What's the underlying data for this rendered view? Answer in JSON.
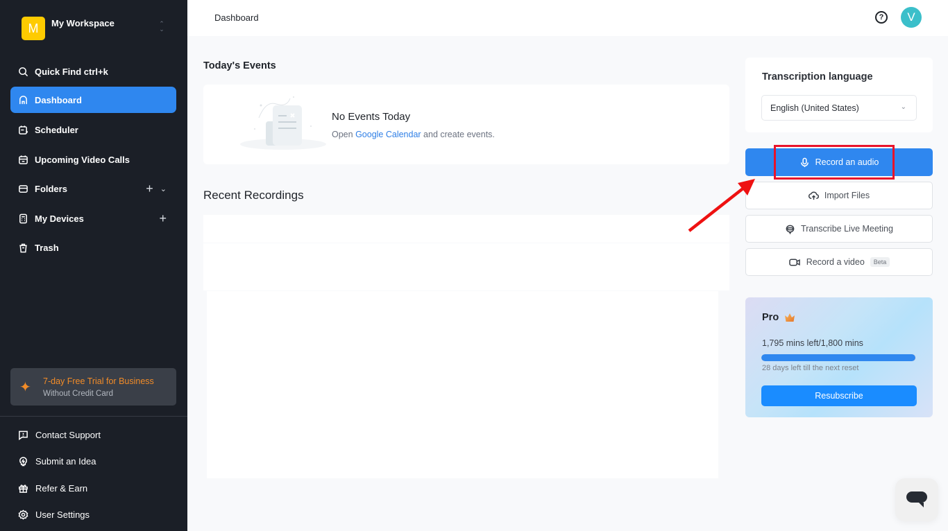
{
  "sidebar": {
    "workspace": {
      "initial": "M",
      "name": "My Workspace",
      "switch_icon": "chevron-up-down-icon"
    },
    "nav": [
      {
        "label": "Quick Find ctrl+k",
        "icon": "search-icon"
      },
      {
        "label": "Dashboard",
        "icon": "home-icon",
        "active": true
      },
      {
        "label": "Scheduler",
        "icon": "calendar-plus-icon"
      },
      {
        "label": "Upcoming Video Calls",
        "icon": "calendar-icon"
      },
      {
        "label": "Folders",
        "icon": "folder-icon",
        "actions": [
          "+",
          "⌄"
        ]
      },
      {
        "label": "My Devices",
        "icon": "device-icon",
        "actions": [
          "+"
        ]
      },
      {
        "label": "Trash",
        "icon": "trash-icon"
      }
    ],
    "trial": {
      "title": "7-day Free Trial for Business",
      "subtitle": "Without Credit Card"
    },
    "bottom": [
      {
        "label": "Contact Support",
        "icon": "message-alert-icon"
      },
      {
        "label": "Submit an Idea",
        "icon": "lightbulb-icon"
      },
      {
        "label": "Refer & Earn",
        "icon": "gift-icon"
      },
      {
        "label": "User Settings",
        "icon": "gear-icon"
      }
    ]
  },
  "header": {
    "title": "Dashboard",
    "help": "?",
    "user_initial": "V"
  },
  "events": {
    "section_title": "Today's Events",
    "empty_title": "No Events Today",
    "empty_prefix": "Open ",
    "empty_link": "Google Calendar",
    "empty_suffix": " and create events."
  },
  "recordings": {
    "section_title": "Recent Recordings"
  },
  "right": {
    "language_label": "Transcription language",
    "language_value": "English (United States)",
    "actions": [
      {
        "label": "Record an audio",
        "icon": "microphone-icon"
      },
      {
        "label": "Import Files",
        "icon": "cloud-upload-icon"
      },
      {
        "label": "Transcribe Live Meeting",
        "icon": "live-meeting-icon"
      },
      {
        "label": "Record a video",
        "icon": "video-camera-icon",
        "badge": "Beta"
      }
    ],
    "plan": {
      "name": "Pro",
      "usage": "1,795 mins left/1,800 mins",
      "used_fraction": 0.997,
      "reset": "28 days left till the next reset",
      "button": "Resubscribe"
    }
  },
  "colors": {
    "accent": "#2f87ef",
    "sidebar_bg": "#1b1f27",
    "trial_orange": "#f28c28",
    "highlight": "#e8132a"
  }
}
